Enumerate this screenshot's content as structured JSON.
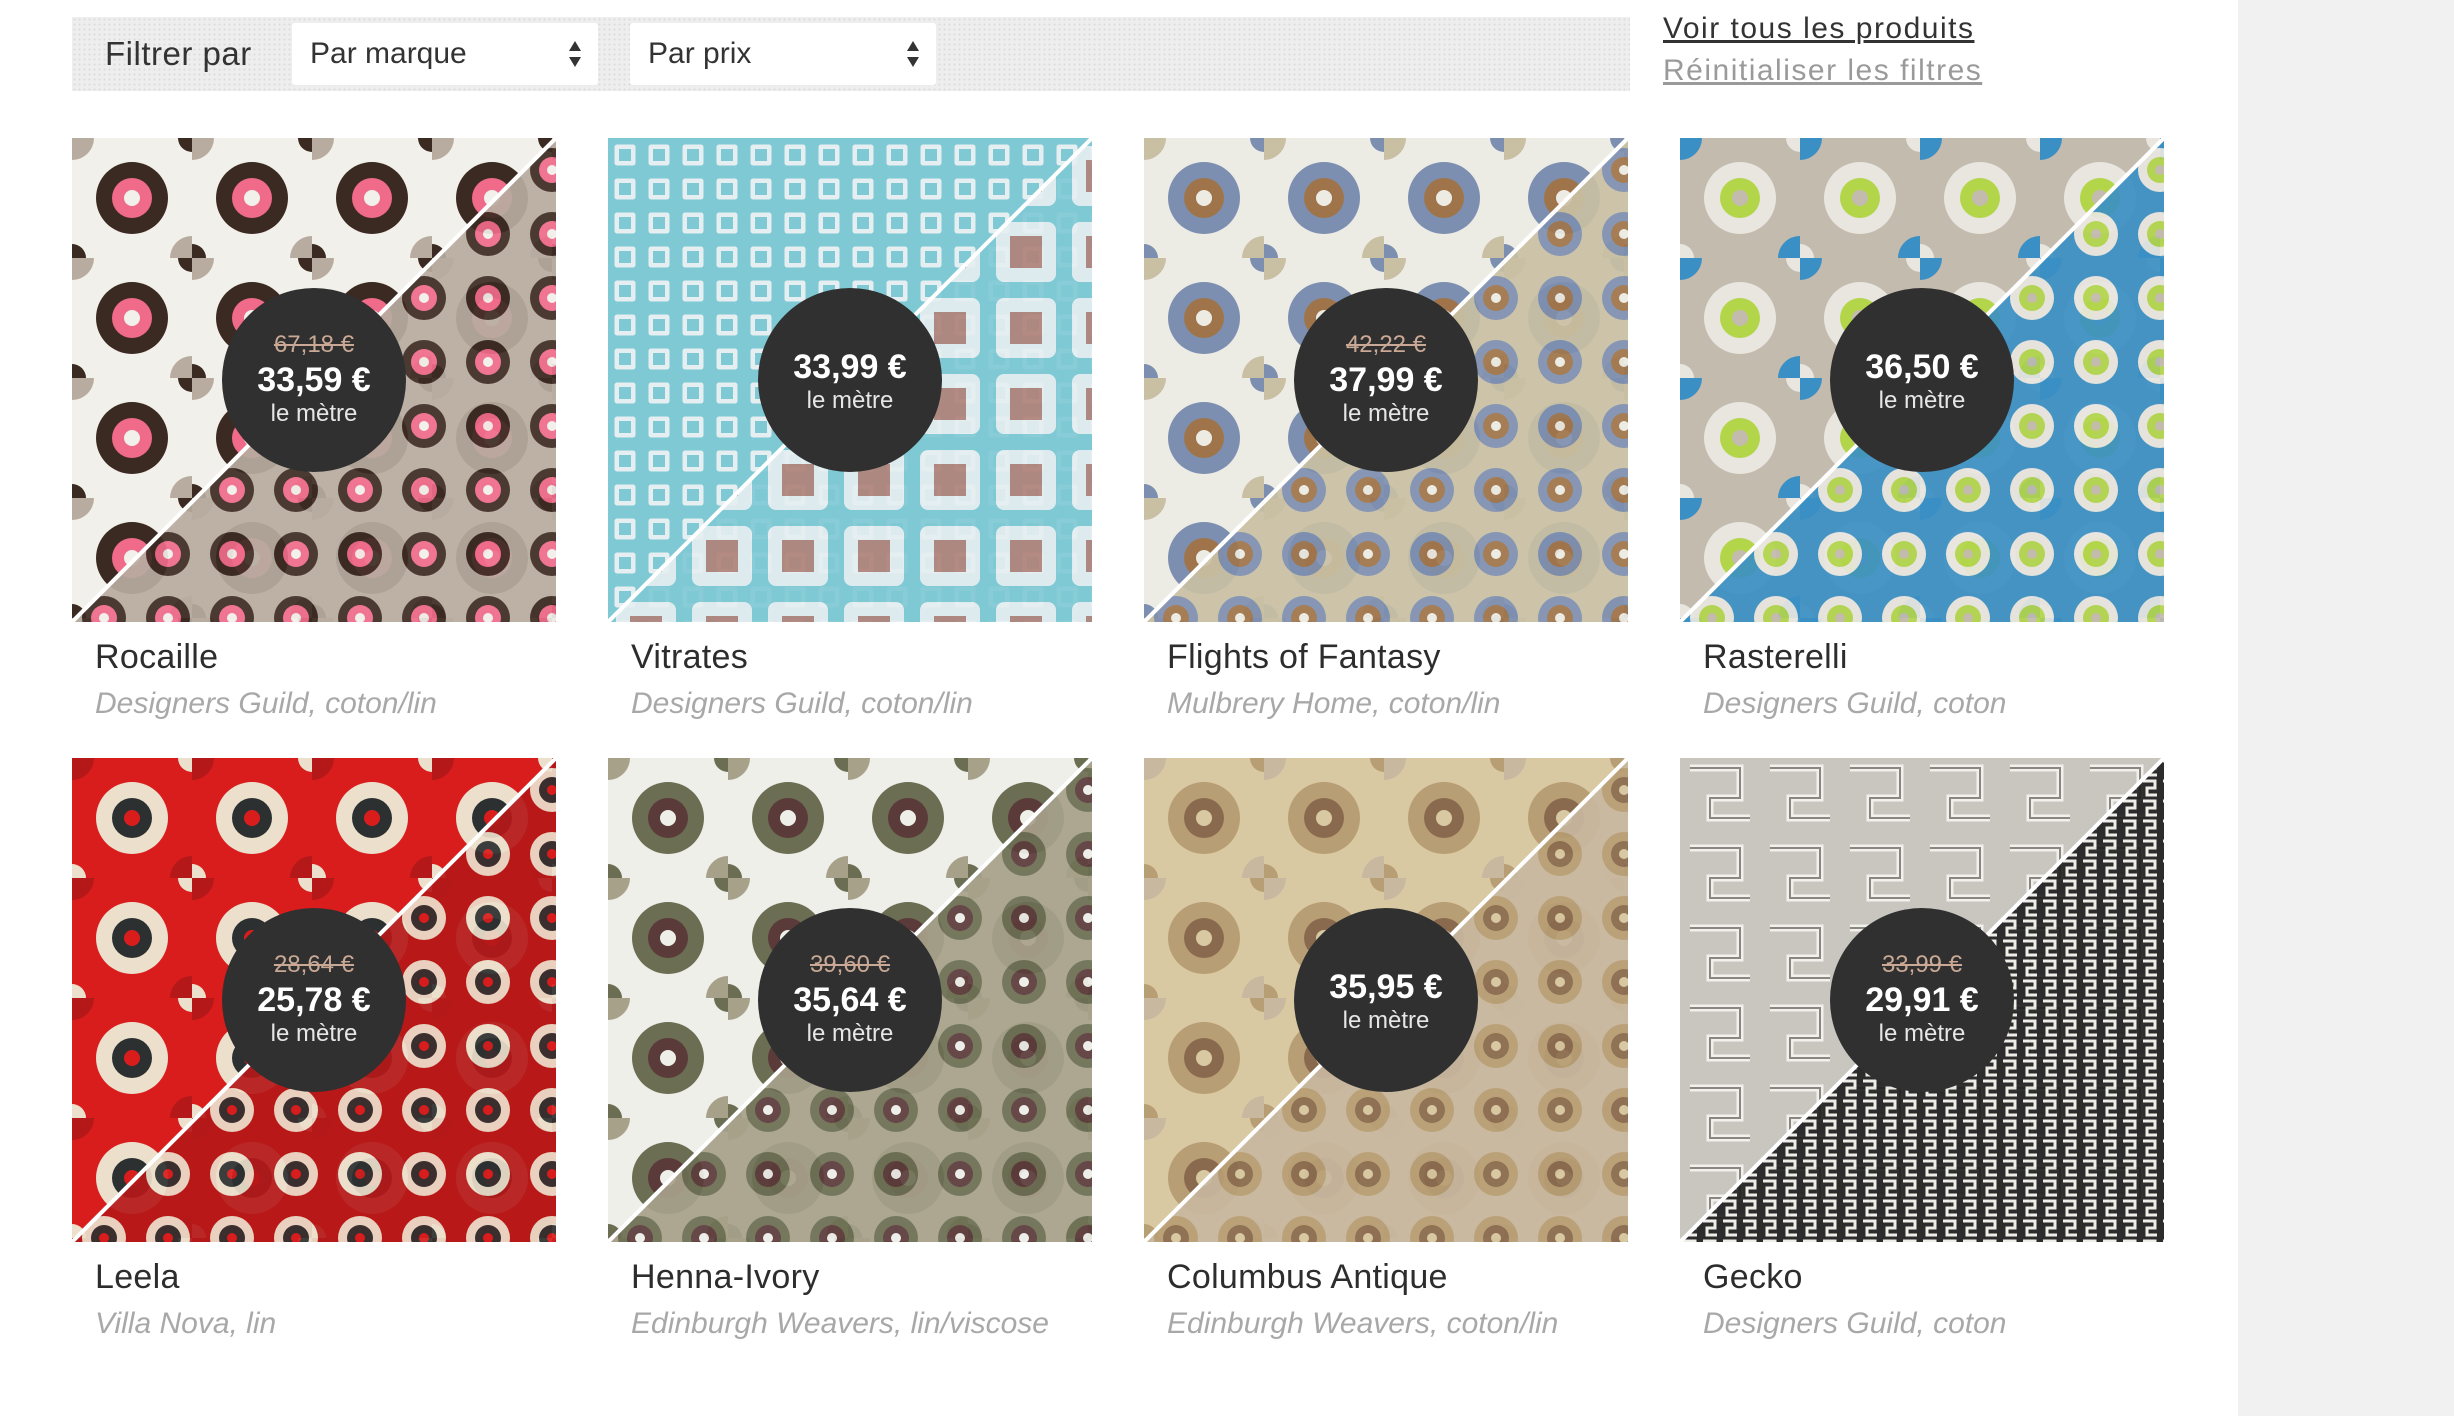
{
  "filters": {
    "label": "Filtrer par",
    "brand_select": "Par marque",
    "price_select": "Par prix"
  },
  "links": {
    "view_all": "Voir tous les produits",
    "reset": "Réinitialiser les filtres"
  },
  "unit_label": "le mètre",
  "products": [
    {
      "name": "Rocaille",
      "desc": "Designers Guild, coton/lin",
      "old_price": "67,18 €",
      "price": "33,59 €",
      "unit": "le mètre",
      "pattern": "damask-brown-pink",
      "colors": [
        "#f2f0ea",
        "#3b2a22",
        "#f06a8a",
        "#b8aca0"
      ]
    },
    {
      "name": "Vitrates",
      "desc": "Designers Guild, coton/lin",
      "old_price": "",
      "price": "33,99 €",
      "unit": "le mètre",
      "pattern": "squares-turquoise",
      "colors": [
        "#7fc9d4",
        "#e5eef0",
        "#e6d43a",
        "#b0827a"
      ]
    },
    {
      "name": "Flights of Fantasy",
      "desc": "Mulbrery Home, coton/lin",
      "old_price": "42,22 €",
      "price": "37,99 €",
      "unit": "le mètre",
      "pattern": "balloons",
      "colors": [
        "#ecebe4",
        "#7d8fb0",
        "#a0744a",
        "#c9c0a4"
      ]
    },
    {
      "name": "Rasterelli",
      "desc": "Designers Guild, coton",
      "old_price": "",
      "price": "36,50 €",
      "unit": "le mètre",
      "pattern": "damask-green-blue",
      "colors": [
        "#c4bbaf",
        "#e9e6e0",
        "#b2d54a",
        "#3a8fc4"
      ]
    },
    {
      "name": "Leela",
      "desc": "Villa Nova, lin",
      "old_price": "28,64 €",
      "price": "25,78 €",
      "unit": "le mètre",
      "pattern": "medallions-red",
      "colors": [
        "#d91c1c",
        "#ece0cc",
        "#2c3030",
        "#b51818"
      ]
    },
    {
      "name": "Henna-Ivory",
      "desc": "Edinburgh Weavers, lin/viscose",
      "old_price": "39,60 €",
      "price": "35,64 €",
      "unit": "le mètre",
      "pattern": "floral-ivory",
      "colors": [
        "#efefe9",
        "#6b6e52",
        "#5b3a3a",
        "#a7a18a"
      ]
    },
    {
      "name": "Columbus Antique",
      "desc": "Edinburgh Weavers, coton/lin",
      "old_price": "",
      "price": "35,95 €",
      "unit": "le mètre",
      "pattern": "antique-map",
      "colors": [
        "#d9c9a2",
        "#b89e74",
        "#8a6a4e",
        "#c8b8a0"
      ]
    },
    {
      "name": "Gecko",
      "desc": "Designers Guild, coton",
      "old_price": "33,99 €",
      "price": "29,91 €",
      "unit": "le mètre",
      "pattern": "fret-grey",
      "colors": [
        "#c9c6c0",
        "#f2f0ec",
        "#1f1f1f",
        "#8a8781"
      ]
    }
  ]
}
